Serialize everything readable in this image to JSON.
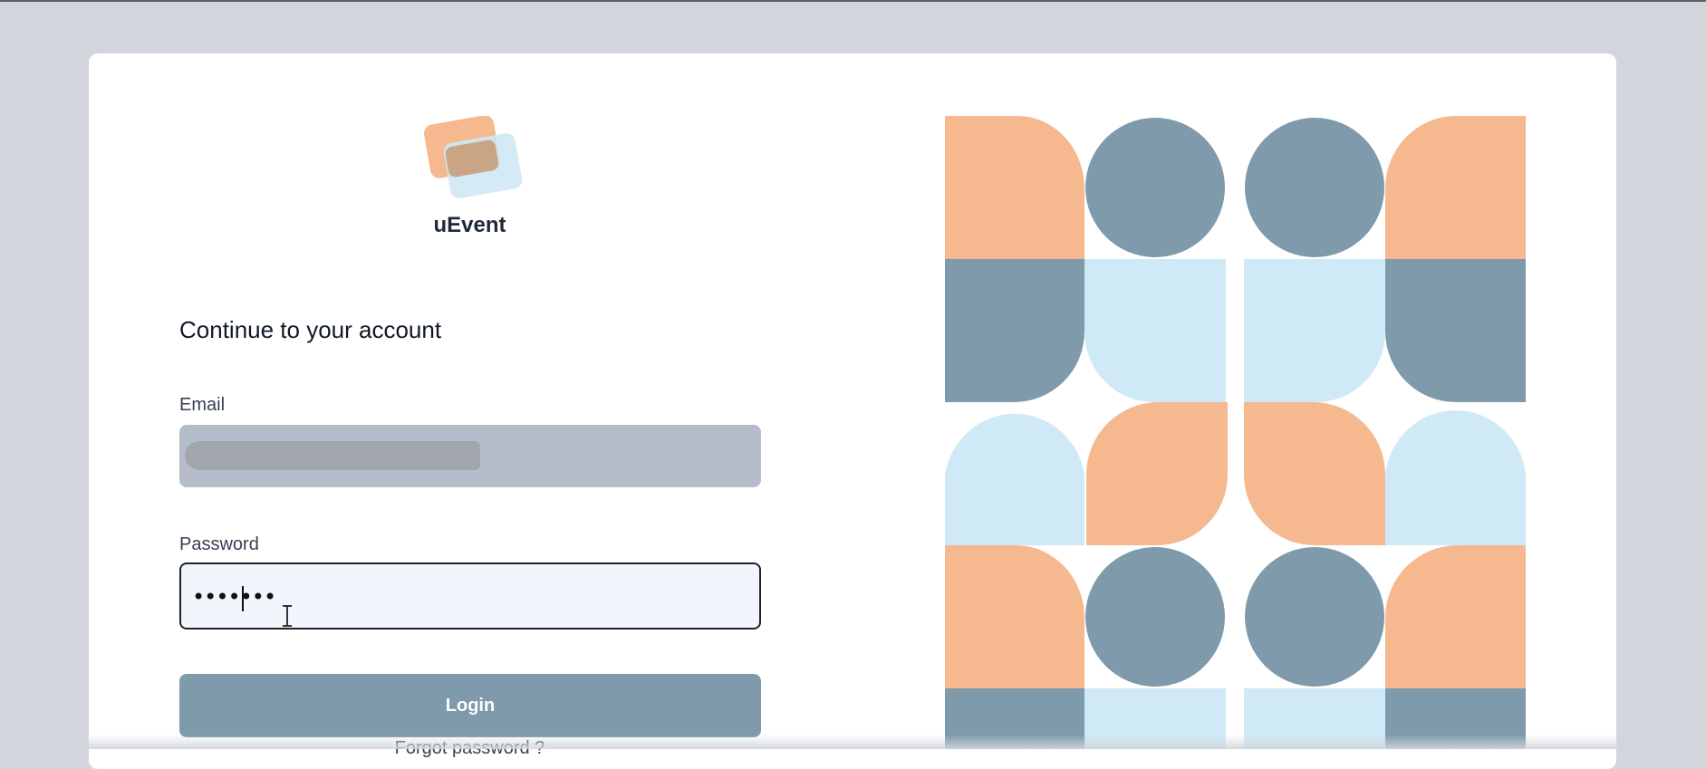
{
  "app": {
    "brand_name": "uEvent"
  },
  "login_form": {
    "heading": "Continue to your account",
    "email_label": "Email",
    "email_value": "",
    "password_label": "Password",
    "password_value": "•••••••",
    "login_label": "Login",
    "forgot_password_label": "Forgot password ?"
  },
  "colors": {
    "peach": "#f6b88e",
    "slate": "#7e9aab",
    "light_blue": "#d0e9f6",
    "card": "#ffffff",
    "background": "#d2d6dc",
    "button": "#7e9aab"
  },
  "icons": {
    "logo": "overlapping-cards-logo",
    "cursor": "text-cursor-icon"
  }
}
